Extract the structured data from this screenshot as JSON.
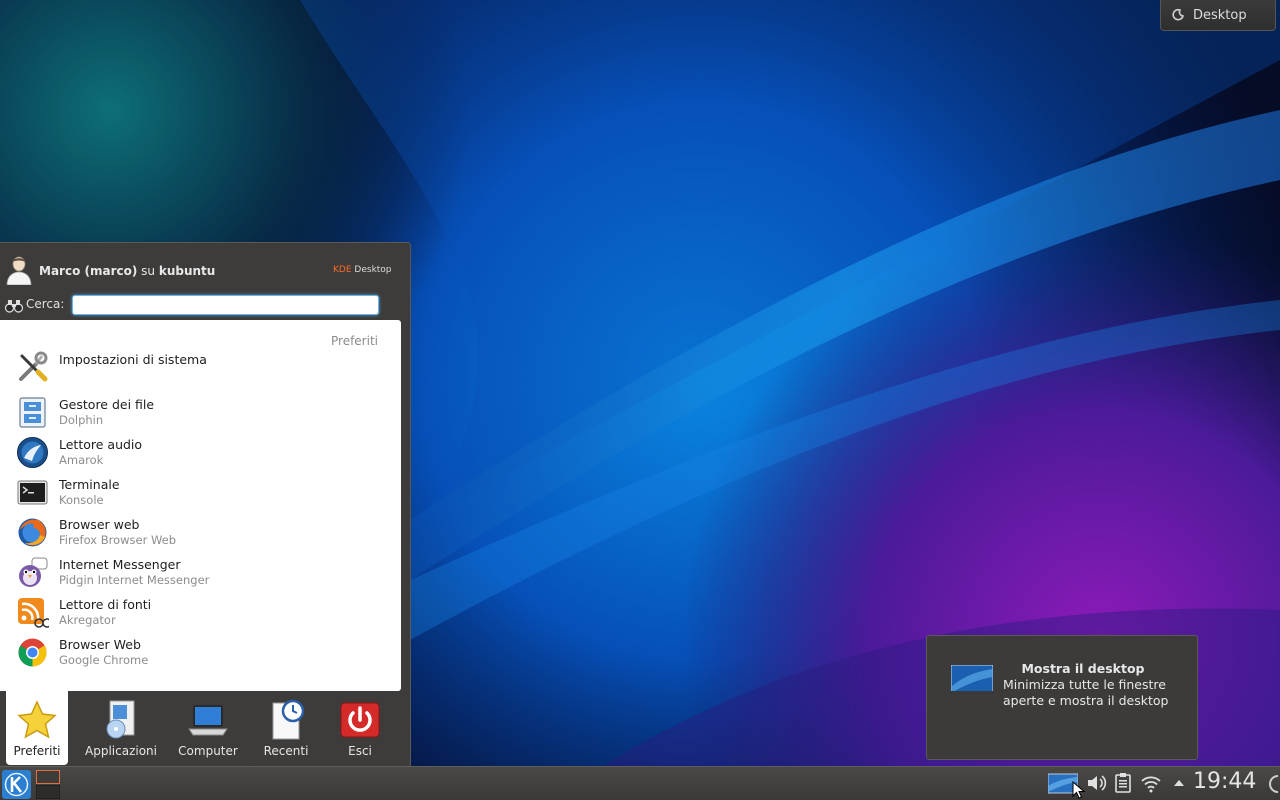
{
  "desktop_toolbox": {
    "label": "Desktop"
  },
  "kickoff": {
    "user": {
      "name": "Marco (marco)",
      "connector": "su",
      "host": "kubuntu"
    },
    "brand": {
      "prefix": "KDE",
      "suffix": "Desktop"
    },
    "search": {
      "label": "Cerca:",
      "value": "",
      "placeholder": ""
    },
    "list_title": "Preferiti",
    "items": [
      {
        "name": "Impostazioni di sistema",
        "sub": "",
        "icon": "tools-icon"
      },
      {
        "name": "Gestore dei file",
        "sub": "Dolphin",
        "icon": "file-manager-icon"
      },
      {
        "name": "Lettore audio",
        "sub": "Amarok",
        "icon": "amarok-icon"
      },
      {
        "name": "Terminale",
        "sub": "Konsole",
        "icon": "terminal-icon"
      },
      {
        "name": "Browser web",
        "sub": "Firefox Browser Web",
        "icon": "firefox-icon"
      },
      {
        "name": "Internet Messenger",
        "sub": "Pidgin Internet Messenger",
        "icon": "pidgin-icon"
      },
      {
        "name": "Lettore di fonti",
        "sub": "Akregator",
        "icon": "rss-icon"
      },
      {
        "name": "Browser Web",
        "sub": "Google Chrome",
        "icon": "chrome-icon"
      }
    ],
    "tabs": [
      {
        "label": "Preferiti",
        "icon": "star-icon",
        "active": true
      },
      {
        "label": "Applicazioni",
        "icon": "applications-icon",
        "active": false
      },
      {
        "label": "Computer",
        "icon": "computer-icon",
        "active": false
      },
      {
        "label": "Recenti",
        "icon": "recent-icon",
        "active": false
      },
      {
        "label": "Esci",
        "icon": "power-icon",
        "active": false
      }
    ]
  },
  "tooltip": {
    "title": "Mostra il desktop",
    "body": "Minimizza tutte le finestre aperte e mostra il desktop"
  },
  "taskbar": {
    "clock": "19:44"
  },
  "colors": {
    "panel": "#3d3c3a",
    "accent": "#ff6a2a",
    "focus": "#6cb4e6"
  }
}
